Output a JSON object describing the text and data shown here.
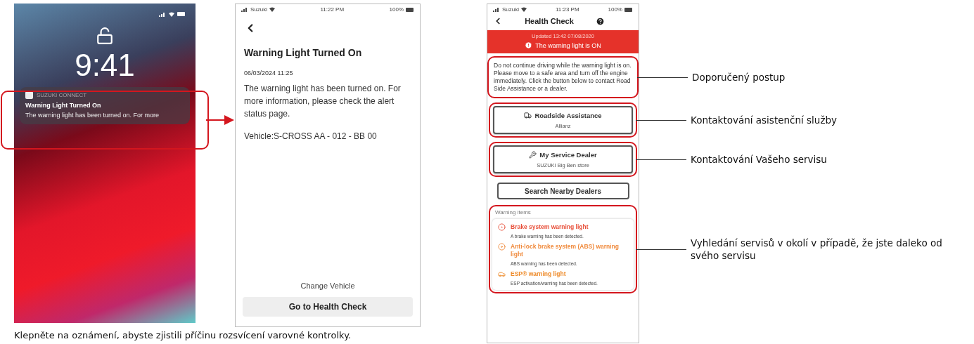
{
  "lock_screen": {
    "time": "9:41",
    "notification": {
      "app": "SUZUKI CONNECT",
      "title": "Warning Light Turned On",
      "body": "The warning light has been turned on. For more"
    }
  },
  "caption": "Klepněte na oznámení, abyste zjistili příčinu rozsvícení varovné kontrolky.",
  "detail_screen": {
    "status_bar": {
      "carrier": "Suzuki",
      "time": "11:22 PM",
      "battery": "100%"
    },
    "title": "Warning Light Turned On",
    "date": "06/03/2024 11:25",
    "message": "The warning light has been turned on. For more information, please check the alert status page.",
    "vehicle": "Vehicle:S-CROSS AA - 012 - BB 00",
    "change_vehicle": "Change Vehicle",
    "primary_button": "Go to Health Check"
  },
  "health_check_screen": {
    "status_bar": {
      "carrier": "Suzuki",
      "time": "11:23 PM",
      "battery": "100%"
    },
    "title": "Health Check",
    "banner": {
      "updated": "Updated 13:42 07/08/2020",
      "message": "The warning light is ON"
    },
    "advice": "Do not continue driving while the warning light is on. Please move to a safe area and turn off the engine immediately. Click the button below to contact Road Side Assistance or a dealer.",
    "contacts": [
      {
        "kind": "roadside",
        "title": "Roadside Assistance",
        "subtitle": "Allianz"
      },
      {
        "kind": "dealer",
        "title": "My Service Dealer",
        "subtitle": "SUZUKI Big Ben store"
      }
    ],
    "search_button": "Search Nearby Dealers",
    "warning_items": {
      "heading": "Warning items",
      "items": [
        {
          "kind": "brake",
          "title": "Brake system warning light",
          "description": "A brake warning has been detected.",
          "color": "#e8503a"
        },
        {
          "kind": "abs",
          "title": "Anti-lock brake system (ABS) warning light",
          "description": "ABS warning has been detected.",
          "color": "#f08a3c"
        },
        {
          "kind": "esp",
          "title": "ESP® warning light",
          "description": "ESP activation/warning has been detected.",
          "color": "#ee8a28"
        }
      ]
    }
  },
  "annotations": [
    {
      "label": "Doporučený postup"
    },
    {
      "label": "Kontaktování asistenční služby"
    },
    {
      "label": "Kontaktování Vašeho servisu"
    },
    {
      "label": "Vyhledání servisů v okolí v případě, že jste daleko od svého servisu"
    }
  ]
}
